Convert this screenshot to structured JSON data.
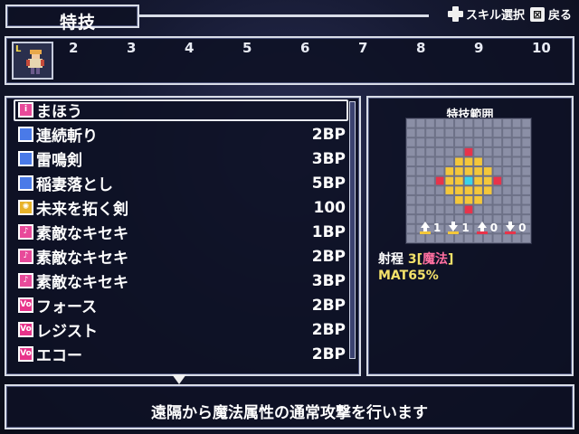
{
  "header": {
    "title": "特技",
    "hint_skill_select": "スキル選択",
    "hint_back": "戻る",
    "icons": [
      "dpad-icon",
      "x-button-icon"
    ]
  },
  "party": {
    "slots": [
      "2",
      "3",
      "4",
      "5",
      "6",
      "7",
      "8",
      "9",
      "10"
    ],
    "active_badge": "L"
  },
  "skills": [
    {
      "name": "まほう",
      "cost": "",
      "icon": "magic-wand-icon",
      "icon_color": "#e84a9a",
      "icon_glyph": "ⅰ",
      "selected": true
    },
    {
      "name": "連続斬り",
      "cost": "2BP",
      "icon": "blue-orb-icon",
      "icon_color": "#4a7ae8",
      "icon_glyph": "",
      "selected": false
    },
    {
      "name": "雷鳴剣",
      "cost": "3BP",
      "icon": "blue-orb-icon",
      "icon_color": "#4a7ae8",
      "icon_glyph": "",
      "selected": false
    },
    {
      "name": "稲妻落とし",
      "cost": "5BP",
      "icon": "blue-orb-icon",
      "icon_color": "#4a7ae8",
      "icon_glyph": "",
      "selected": false
    },
    {
      "name": "未来を拓く剣",
      "cost": "100",
      "icon": "gold-emblem-icon",
      "icon_color": "#e8b32a",
      "icon_glyph": "✺",
      "selected": false
    },
    {
      "name": "素敵なキセキ",
      "cost": "1BP",
      "icon": "music-note-icon",
      "icon_color": "#e84a9a",
      "icon_glyph": "♪",
      "selected": false
    },
    {
      "name": "素敵なキセキ",
      "cost": "2BP",
      "icon": "music-note-plus1-icon",
      "icon_color": "#e84a9a",
      "icon_glyph": "♪",
      "selected": false
    },
    {
      "name": "素敵なキセキ",
      "cost": "3BP",
      "icon": "music-note-plus2-icon",
      "icon_color": "#e84a9a",
      "icon_glyph": "♪",
      "selected": false
    },
    {
      "name": "フォース",
      "cost": "2BP",
      "icon": "voice-icon",
      "icon_color": "#e8338a",
      "icon_glyph": "Vo",
      "selected": false
    },
    {
      "name": "レジスト",
      "cost": "2BP",
      "icon": "voice-icon",
      "icon_color": "#e8338a",
      "icon_glyph": "Vo",
      "selected": false
    },
    {
      "name": "エコー",
      "cost": "2BP",
      "icon": "voice-icon",
      "icon_color": "#e8338a",
      "icon_glyph": "Vo",
      "selected": false
    }
  ],
  "range_panel": {
    "title": "特技範囲",
    "counts": [
      {
        "value": "1",
        "icon": "yellow-up-arrow-icon",
        "color": "#f4c73a"
      },
      {
        "value": "1",
        "icon": "yellow-down-arrow-icon",
        "color": "#f4c73a"
      },
      {
        "value": "0",
        "icon": "red-up-arrow-icon",
        "color": "#e8334a"
      },
      {
        "value": "0",
        "icon": "red-down-arrow-icon",
        "color": "#e8334a"
      }
    ],
    "range_label": "射程",
    "range_value": "3",
    "range_type_open": "[",
    "range_type": "魔法",
    "range_type_close": "]",
    "stat_name": "MAT",
    "stat_value": "65%",
    "grid": {
      "cells": 13,
      "center_color": "#3ad4e8",
      "area_color": "#f4c73a",
      "edge_color": "#e8334a"
    }
  },
  "description": "遠隔から魔法属性の通常攻撃を行います",
  "colors": {
    "frame_border": "#d9dde8",
    "panel_bg": "#0e1124",
    "highlight_yellow": "#f4e26a",
    "highlight_pink": "#ff6fa0"
  }
}
